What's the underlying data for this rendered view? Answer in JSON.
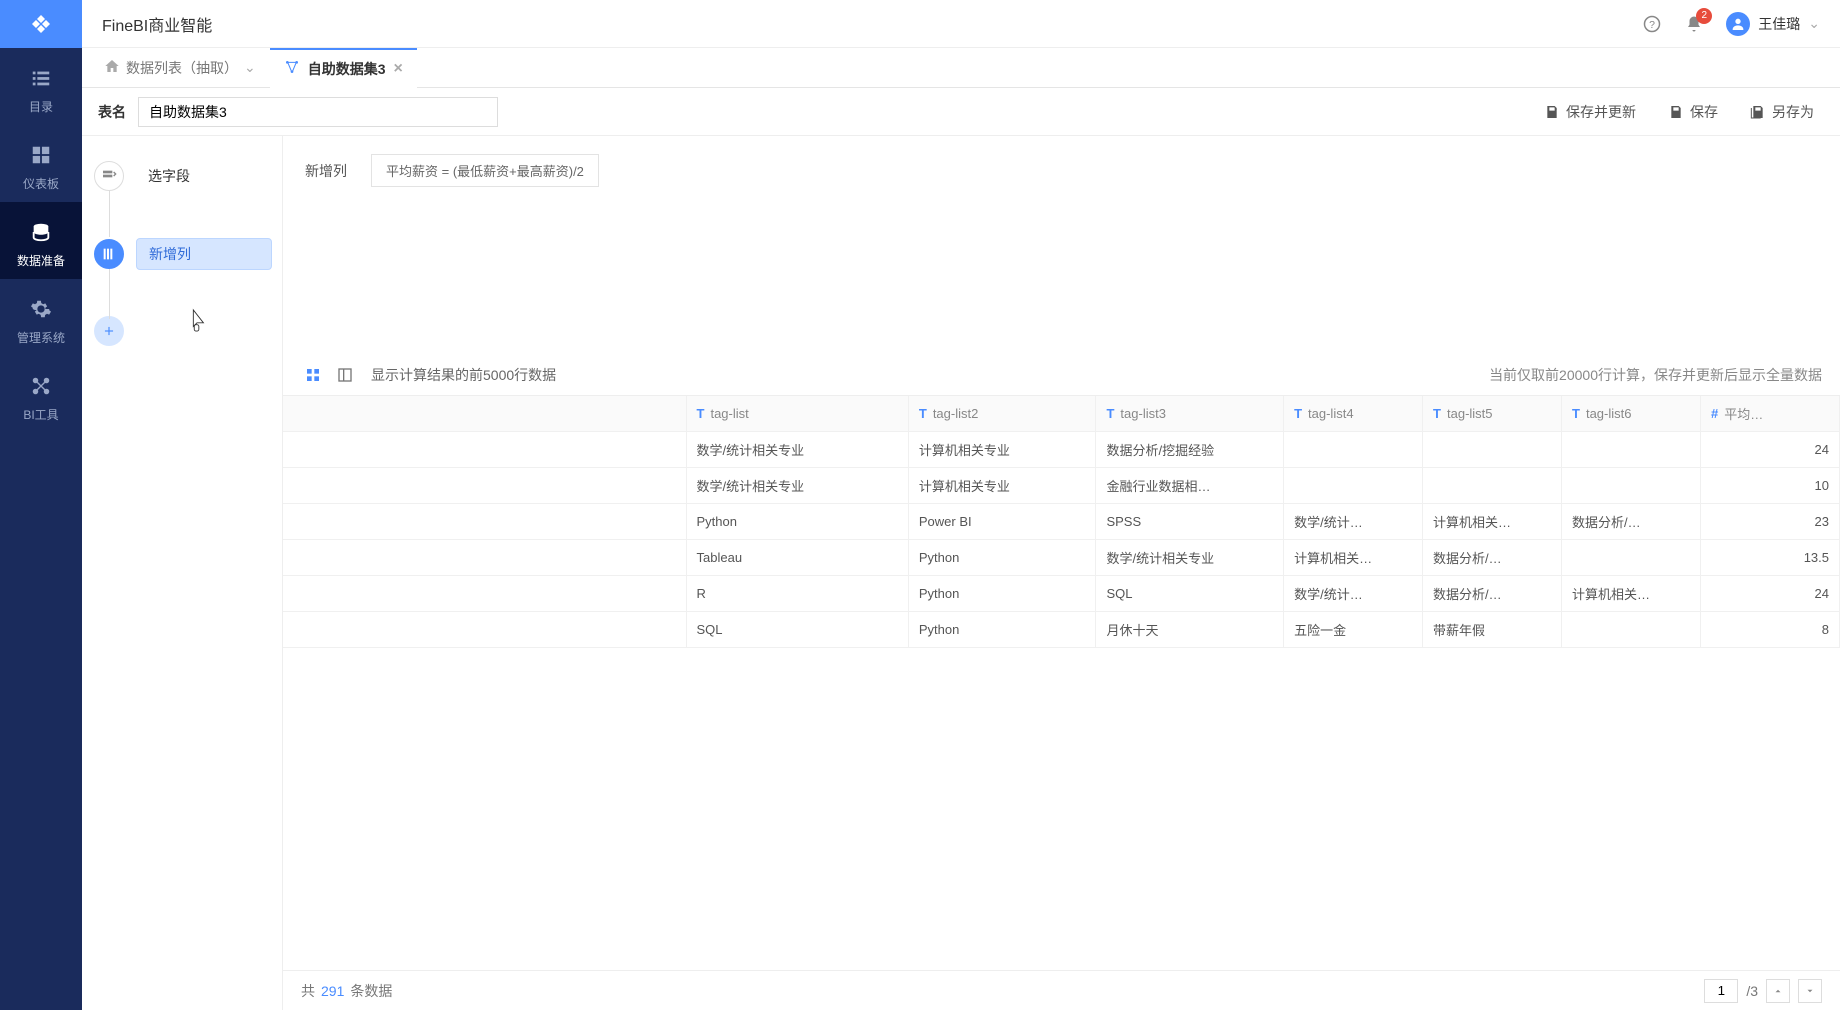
{
  "product_title": "FineBI商业智能",
  "notification_count": "2",
  "username": "王佳璐",
  "nav": [
    {
      "label": "目录"
    },
    {
      "label": "仪表板"
    },
    {
      "label": "数据准备"
    },
    {
      "label": "管理系统"
    },
    {
      "label": "BI工具"
    }
  ],
  "breadcrumb": {
    "label": "数据列表（抽取）"
  },
  "tab": {
    "label": "自助数据集3"
  },
  "table_name_label": "表名",
  "table_name_value": "自助数据集3",
  "save_update": "保存并更新",
  "save": "保存",
  "save_as": "另存为",
  "steps": {
    "select_fields": "选字段",
    "new_column": "新增列"
  },
  "formula": {
    "label": "新增列",
    "text": "平均薪资 = (最低薪资+最高薪资)/2"
  },
  "preview": {
    "left_note": "显示计算结果的前5000行数据",
    "right_note": "当前仅取前20000行计算，保存并更新后显示全量数据"
  },
  "columns": [
    {
      "type": "T",
      "name": "tag-list"
    },
    {
      "type": "T",
      "name": "tag-list2"
    },
    {
      "type": "T",
      "name": "tag-list3"
    },
    {
      "type": "T",
      "name": "tag-list4"
    },
    {
      "type": "T",
      "name": "tag-list5"
    },
    {
      "type": "T",
      "name": "tag-list6"
    },
    {
      "type": "#",
      "name": "平均…"
    }
  ],
  "rows": [
    [
      "数学/统计相关专业",
      "计算机相关专业",
      "数据分析/挖掘经验",
      "",
      "",
      "",
      "24"
    ],
    [
      "数学/统计相关专业",
      "计算机相关专业",
      "金融行业数据相…",
      "",
      "",
      "",
      "10"
    ],
    [
      "Python",
      "Power BI",
      "SPSS",
      "数学/统计…",
      "计算机相关…",
      "数据分析/…",
      "23"
    ],
    [
      "Tableau",
      "Python",
      "数学/统计相关专业",
      "计算机相关…",
      "数据分析/…",
      "",
      "13.5"
    ],
    [
      "R",
      "Python",
      "SQL",
      "数学/统计…",
      "数据分析/…",
      "计算机相关…",
      "24"
    ],
    [
      "SQL",
      "Python",
      "月休十天",
      "五险一金",
      "带薪年假",
      "",
      "8"
    ]
  ],
  "footer": {
    "total_prefix": "共",
    "total_count": "291",
    "total_suffix": "条数据",
    "page": "1",
    "pages": "/3"
  }
}
